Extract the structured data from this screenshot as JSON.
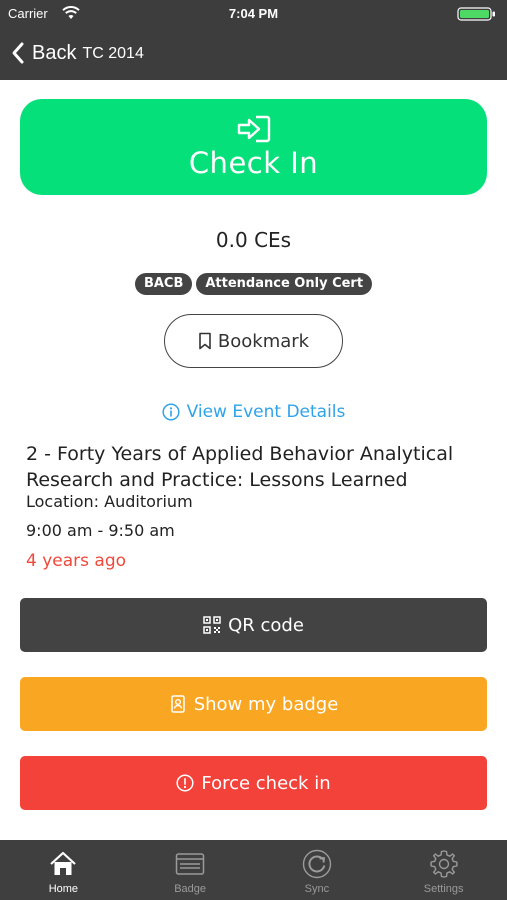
{
  "status_bar": {
    "carrier": "Carrier",
    "time": "7:04 PM"
  },
  "nav": {
    "back_label": "Back",
    "title": "TC 2014"
  },
  "checkin": {
    "label": "Check In",
    "icon": "login-arrow-icon"
  },
  "ces": "0.0 CEs",
  "badges": [
    "BACB",
    "Attendance Only Cert"
  ],
  "bookmark": {
    "label": "Bookmark"
  },
  "event_details_link": "View Event Details",
  "session": {
    "title": "2 - Forty Years of Applied Behavior Analytical Research and Practice: Lessons Learned",
    "location": "Location: Auditorium",
    "time": "9:00 am - 9:50 am",
    "relative": "4 years ago"
  },
  "actions": {
    "qr_label": "QR code",
    "badge_label": "Show my badge",
    "force_label": "Force check in"
  },
  "tabs": [
    {
      "label": "Home",
      "icon": "home-icon",
      "active": true
    },
    {
      "label": "Badge",
      "icon": "badge-card-icon",
      "active": false
    },
    {
      "label": "Sync",
      "icon": "sync-icon",
      "active": false
    },
    {
      "label": "Settings",
      "icon": "gear-icon",
      "active": false
    }
  ],
  "colors": {
    "checkin": "#06e07a",
    "qr": "#434343",
    "badge": "#f9a623",
    "force": "#f2423a",
    "link": "#2fa3e8",
    "relative_time": "#f0493b"
  }
}
